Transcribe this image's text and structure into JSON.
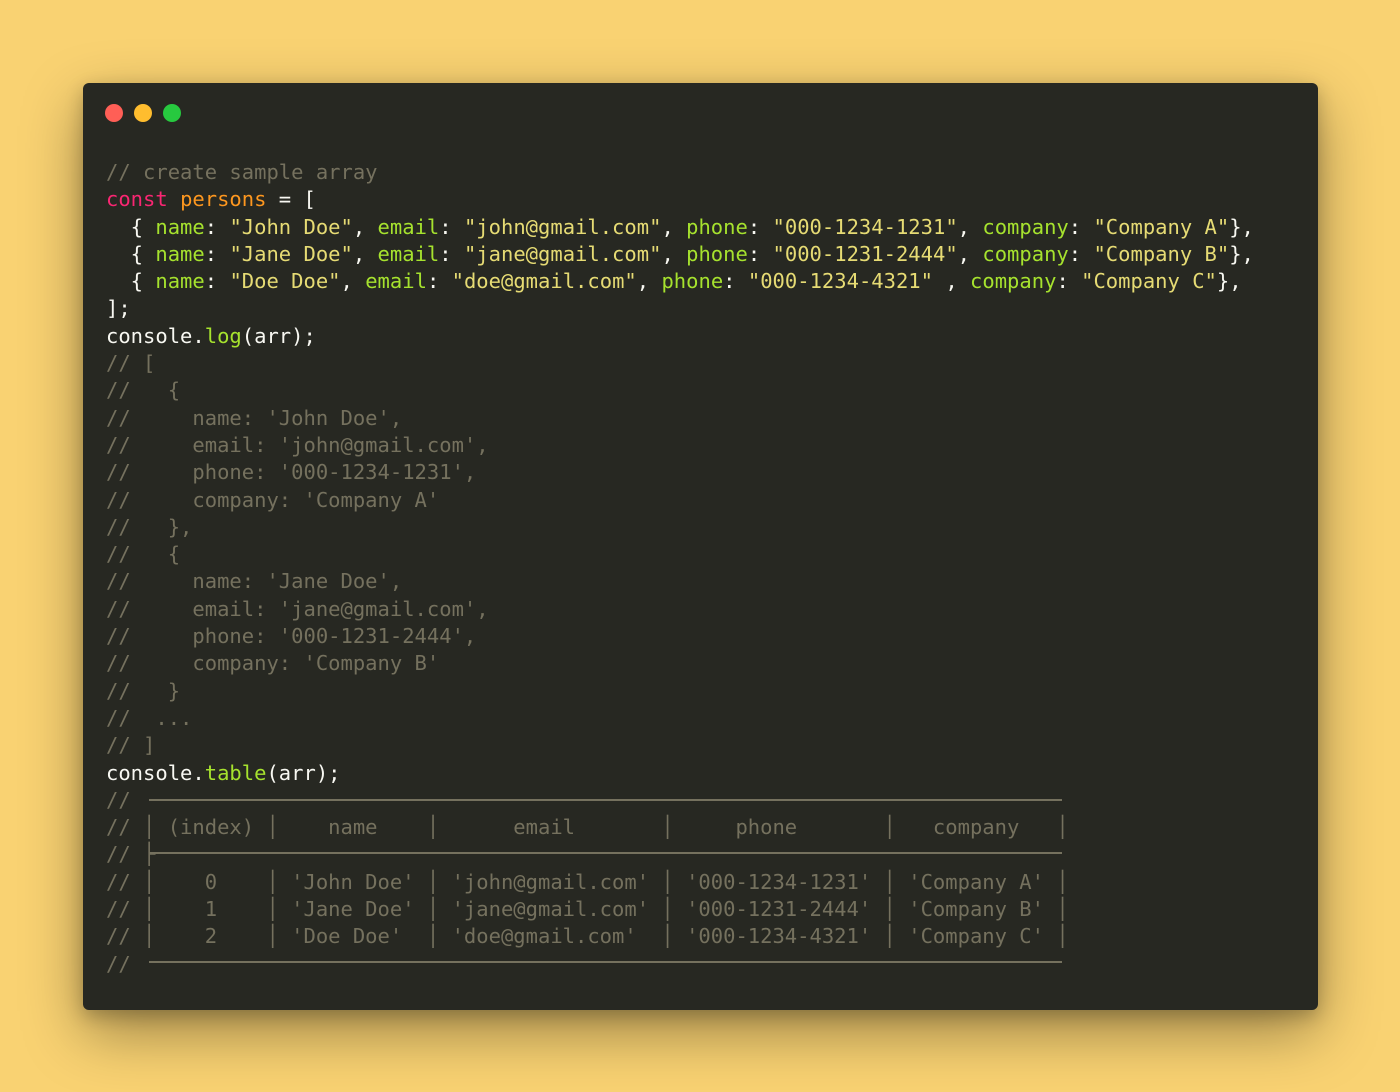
{
  "window": {
    "controls": [
      "close",
      "minimize",
      "maximize"
    ],
    "colors": {
      "close": "#ff5f56",
      "minimize": "#ffbd2e",
      "maximize": "#27c93f",
      "background": "#272822"
    }
  },
  "code": {
    "comment_create": "// create sample array",
    "const_kw": "const",
    "persons_var": "persons",
    "assign_open": " = [",
    "rows": [
      {
        "name": "\"John Doe\"",
        "email": "\"john@gmail.com\"",
        "phone": "\"000-1234-1231\"",
        "phone_gap": ", ",
        "company": "\"Company A\""
      },
      {
        "name": "\"Jane Doe\"",
        "email": "\"jane@gmail.com\"",
        "phone": "\"000-1231-2444\"",
        "phone_gap": ", ",
        "company": "\"Company B\""
      },
      {
        "name": "\"Doe Doe\"",
        "email": "\"doe@gmail.com\"",
        "phone": "\"000-1234-4321\"",
        "phone_gap": " , ",
        "company": "\"Company C\""
      }
    ],
    "keys": {
      "name": "name",
      "email": "email",
      "phone": "phone",
      "company": "company"
    },
    "close_array": "];",
    "console_obj": "console",
    "log_fn": "log",
    "table_fn": "table",
    "call_args": "(arr);",
    "log_output": [
      "// [",
      "//   {",
      "//     name: 'John Doe',",
      "//     email: 'john@gmail.com',",
      "//     phone: '000-1234-1231',",
      "//     company: 'Company A'",
      "//   },",
      "//   {",
      "//     name: 'Jane Doe',",
      "//     email: 'jane@gmail.com',",
      "//     phone: '000-1231-2444',",
      "//     company: 'Company B'",
      "//   }",
      "//  ...",
      "// ]"
    ],
    "table_output": [
      "//",
      "// │ (index) │    name    │      email       │     phone       │   company   │",
      "// ├",
      "// │    0    │ 'John Doe' │ 'john@gmail.com' │ '000-1234-1231' │ 'Company A' │",
      "// │    1    │ 'Jane Doe' │ 'jane@gmail.com' │ '000-1231-2444' │ 'Company B' │",
      "// │    2    │ 'Doe Doe'  │ 'doe@gmail.com'  │ '000-1234-4321' │ 'Company C' │",
      "//"
    ]
  }
}
